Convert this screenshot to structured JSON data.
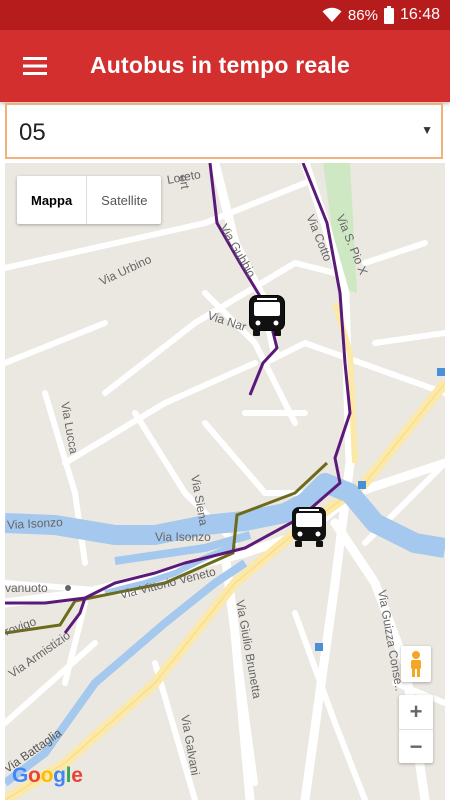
{
  "status": {
    "battery": "86%",
    "time": "16:48"
  },
  "appbar": {
    "title": "Autobus in tempo reale"
  },
  "route_select": {
    "value": "05"
  },
  "map": {
    "toggle": {
      "map_label": "Mappa",
      "satellite_label": "Satellite"
    },
    "streets": {
      "loreto": "Loreto",
      "via_urbino": "Via Urbino",
      "via_nar": "Via Nar",
      "via_gubbio": "Via Gubbio",
      "via_cotto": "Via Cotto",
      "via_s_pio_x": "Via S. Pio X",
      "via_lucca": "Via Lucca",
      "via_siena": "Via Siena",
      "via_isonzo_left": "Via Isonzo",
      "via_isonzo_mid": "Via Isonzo",
      "via_vittorio_veneto": "Via Vittorio Veneto",
      "vanuoto": "vanuoto",
      "via_armistizio": "Via Armistizio",
      "rovigo": "rovigo",
      "via_giulio_brunetta": "Via Giulio Brunetta",
      "via_guizza_conselve": "Via Guizza Conse..",
      "via_galvani": "Via Galvani",
      "via_battaglia": "Via Battaglia",
      "ert": "ert"
    },
    "brand": "Google",
    "brand_colors": [
      "#4285F4",
      "#EA4335",
      "#FBBC05",
      "#4285F4",
      "#34A853",
      "#EA4335"
    ],
    "route_color": "#5b1a7a",
    "alt_route_color": "#6b6b1a",
    "river_color": "#a5c8ee",
    "icons": [
      "bus-icon",
      "bus-icon",
      "pegman-icon"
    ]
  },
  "zoom": {
    "in": "+",
    "out": "−"
  }
}
